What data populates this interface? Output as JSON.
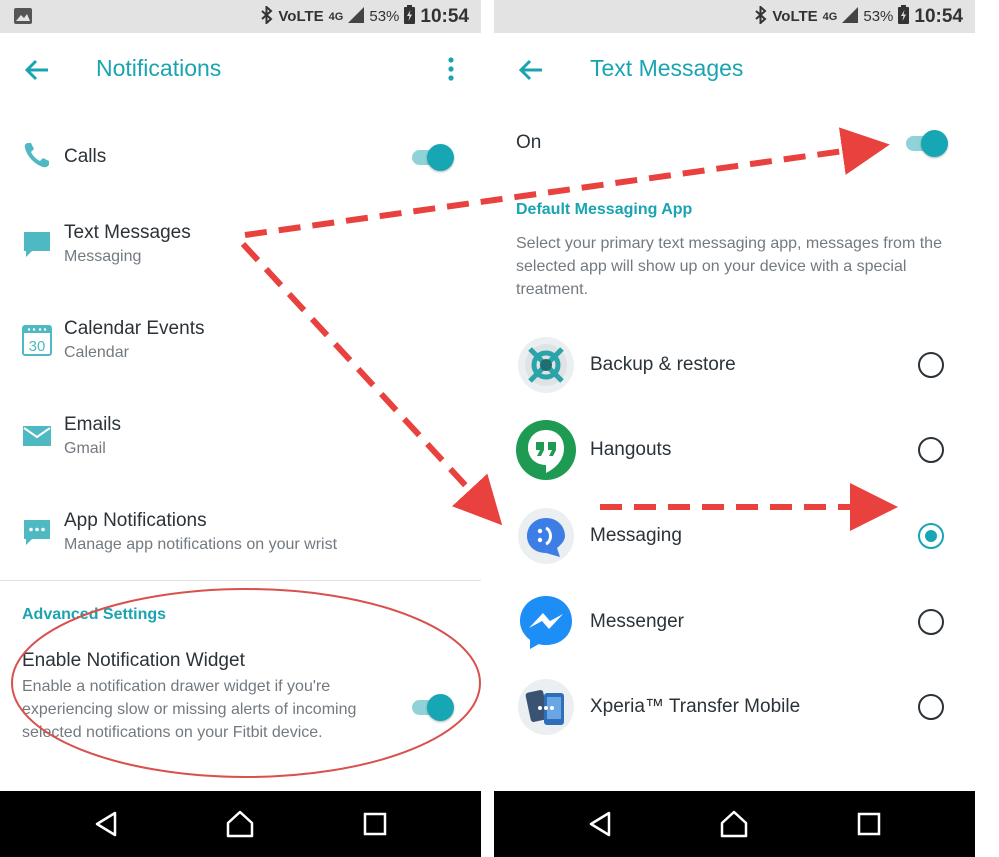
{
  "status_bar": {
    "network": "VoLTE",
    "signal": "4G",
    "battery": "53%",
    "time": "10:54"
  },
  "notifications_screen": {
    "title": "Notifications",
    "items": [
      {
        "title": "Calls",
        "subtitle": "",
        "icon": "phone-icon",
        "has_toggle": true,
        "toggle_on": true
      },
      {
        "title": "Text Messages",
        "subtitle": "Messaging",
        "icon": "chat-bubble-icon"
      },
      {
        "title": "Calendar Events",
        "subtitle": "Calendar",
        "icon": "calendar-icon",
        "icon_text": "30"
      },
      {
        "title": "Emails",
        "subtitle": "Gmail",
        "icon": "mail-icon"
      },
      {
        "title": "App Notifications",
        "subtitle": "Manage app notifications on your wrist",
        "icon": "chat-dots-icon"
      }
    ],
    "advanced": {
      "heading": "Advanced Settings",
      "widget_title": "Enable Notification Widget",
      "widget_description": "Enable a notification drawer widget if you're experiencing slow or missing alerts of incoming selected notifications on your Fitbit device.",
      "widget_on": true
    }
  },
  "text_messages_screen": {
    "title": "Text Messages",
    "on_label": "On",
    "on_state": true,
    "section_heading": "Default Messaging App",
    "description": "Select your primary text messaging app, messages from the selected app will show up on your device with a special treatment.",
    "apps": [
      {
        "name": "Backup & restore",
        "icon": "backup-restore-icon",
        "selected": false
      },
      {
        "name": "Hangouts",
        "icon": "hangouts-icon",
        "selected": false
      },
      {
        "name": "Messaging",
        "icon": "messaging-icon",
        "selected": true
      },
      {
        "name": "Messenger",
        "icon": "messenger-icon",
        "selected": false
      },
      {
        "name": "Xperia™ Transfer Mobile",
        "icon": "xperia-transfer-icon",
        "selected": false
      }
    ]
  },
  "colors": {
    "accent": "#1aa4b2",
    "annotation_arrow": "#e8413e",
    "annotation_ellipse": "#d9504c"
  }
}
